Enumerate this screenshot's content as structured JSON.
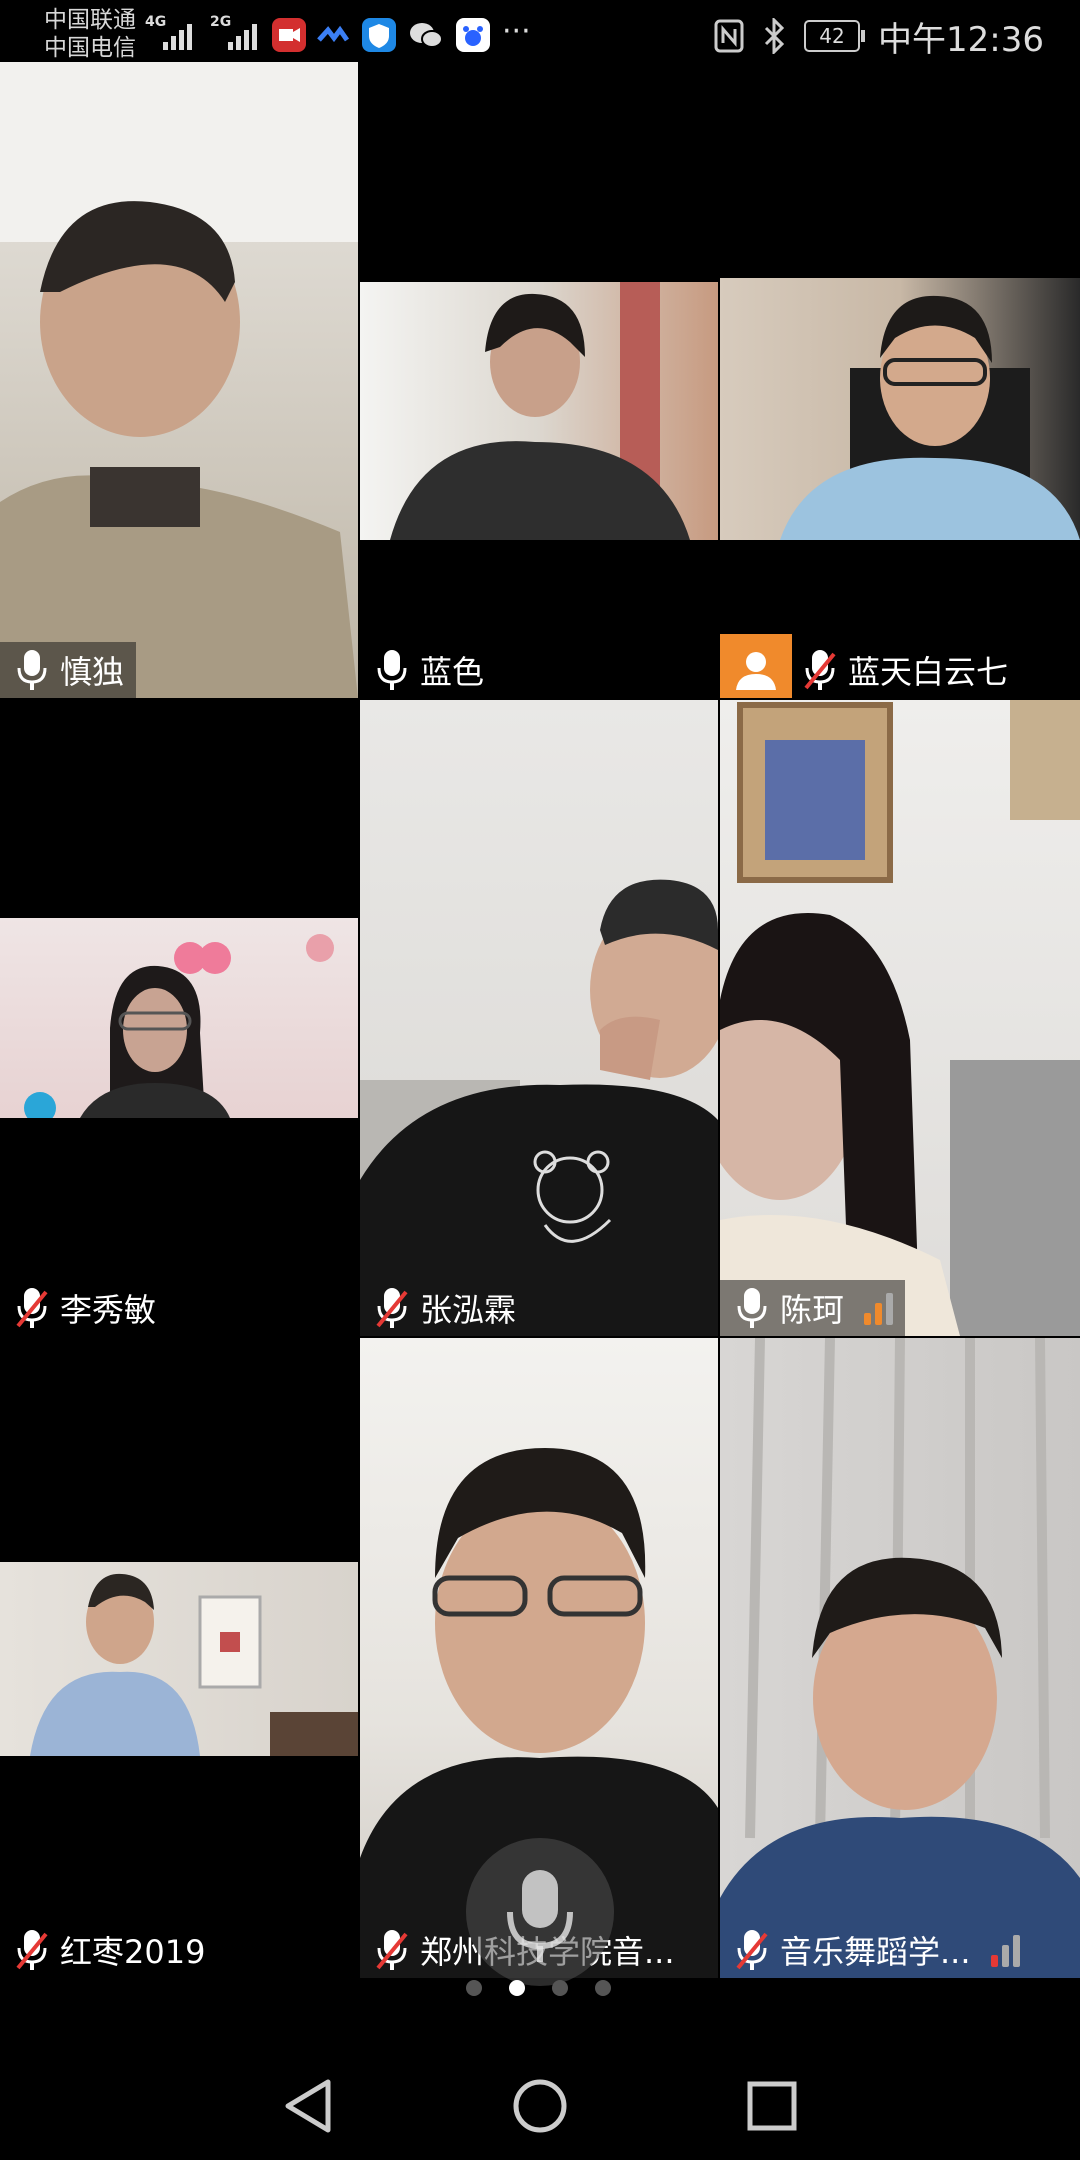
{
  "status_bar": {
    "carrier1": "中国联通",
    "carrier2": "中国电信",
    "net1": "4G",
    "net2": "2G",
    "battery": "42",
    "time": "中午12:36",
    "more": "···"
  },
  "participants": [
    {
      "name": "慎独",
      "muted": false
    },
    {
      "name": "蓝色",
      "muted": false
    },
    {
      "name": "蓝天白云七",
      "muted": true,
      "avatar": true
    },
    {
      "name": "李秀敏",
      "muted": true
    },
    {
      "name": "张泓霖",
      "muted": true
    },
    {
      "name": "陈珂",
      "muted": false,
      "signal": "orange"
    },
    {
      "name": "红枣2019",
      "muted": true
    },
    {
      "name": "郑州科技学院音...",
      "muted": true
    },
    {
      "name": "音乐舞蹈学...",
      "muted": true,
      "signal": "red"
    }
  ],
  "pager": {
    "pages": 4,
    "current": 2
  },
  "colors": {
    "active_border": "#21b24d",
    "avatar_bg": "#f08a2c",
    "signal_orange": "#f08a2c",
    "signal_red": "#e53935"
  }
}
